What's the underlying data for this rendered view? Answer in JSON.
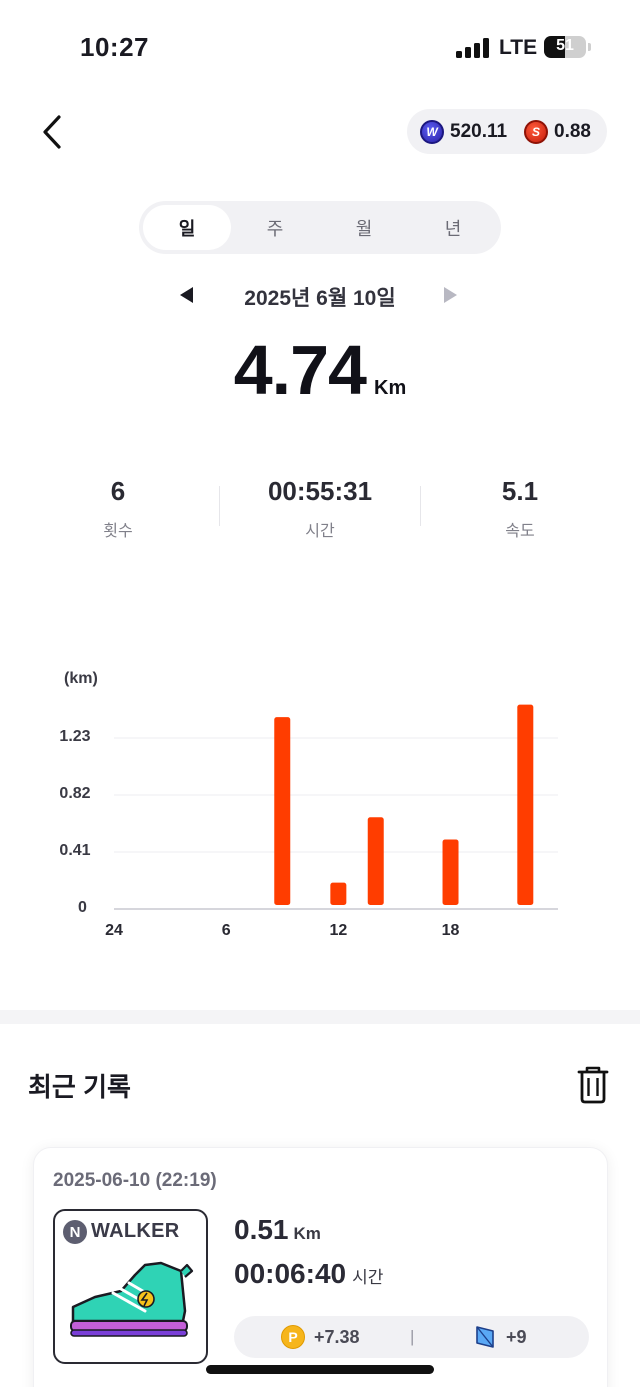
{
  "status_bar": {
    "time": "10:27",
    "network": "LTE",
    "battery": "51",
    "battery_level": 0.51
  },
  "header": {
    "back_icon": "chevron-left-icon",
    "balances": [
      {
        "icon": "w-coin-icon",
        "value": "520.11",
        "color": "#3a32c8"
      },
      {
        "icon": "s-coin-icon",
        "value": "0.88",
        "color": "#e0301a"
      }
    ]
  },
  "period_tabs": [
    {
      "label": "일",
      "active": true
    },
    {
      "label": "주",
      "active": false
    },
    {
      "label": "월",
      "active": false
    },
    {
      "label": "년",
      "active": false
    }
  ],
  "date_nav": {
    "label": "2025년 6월 10일"
  },
  "summary": {
    "distance": "4.74",
    "unit": "Km"
  },
  "stats": [
    {
      "value": "6",
      "label": "횟수"
    },
    {
      "value": "00:55:31",
      "label": "시간"
    },
    {
      "value": "5.1",
      "label": "속도"
    }
  ],
  "chart_data": {
    "type": "bar",
    "ylabel": "(km)",
    "yticks": [
      "1.23",
      "0.82",
      "0.41",
      "0"
    ],
    "ytick_values": [
      1.23,
      0.82,
      0.41,
      0
    ],
    "ylim": [
      0,
      1.64
    ],
    "xticks": [
      "24",
      "6",
      "12",
      "18"
    ],
    "xtick_hours": [
      0,
      6,
      12,
      18
    ],
    "x_range": [
      0,
      23
    ],
    "bar_color": "#ff3d00",
    "grid": true,
    "bars": [
      {
        "hour": 9,
        "value": 1.38
      },
      {
        "hour": 12,
        "value": 0.19
      },
      {
        "hour": 14,
        "value": 0.66
      },
      {
        "hour": 18,
        "value": 0.5
      },
      {
        "hour": 22,
        "value": 1.47
      }
    ]
  },
  "recent": {
    "title": "최근 기록",
    "delete_icon": "trash-icon",
    "record": {
      "datetime": "2025-06-10 (22:19)",
      "brand_badge": "N",
      "brand_text": "WALKER",
      "distance": "0.51",
      "distance_unit": "Km",
      "time": "00:06:40",
      "time_unit": "시간",
      "reward_points": "+7.38",
      "reward_gems": "+9",
      "divider": "|"
    }
  },
  "colors": {
    "accent": "#ff3d00",
    "pill_bg": "#f1f1f4",
    "text_main": "#1a1a22"
  }
}
